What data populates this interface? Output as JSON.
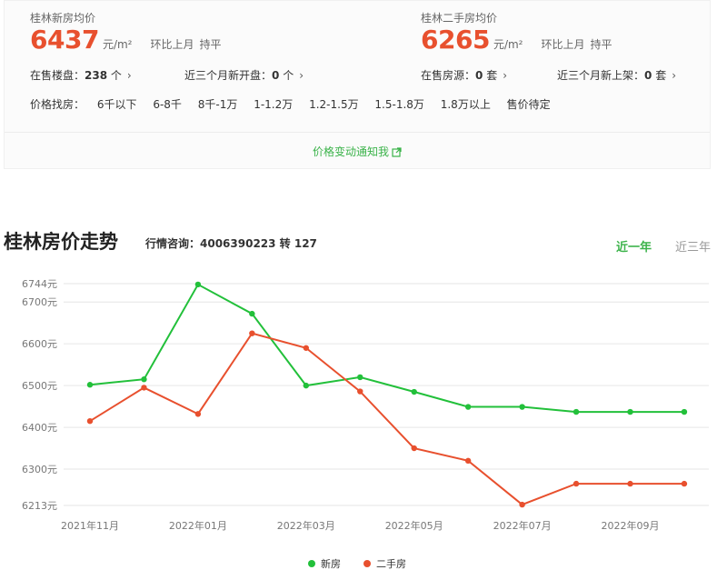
{
  "colors": {
    "new": "#22c03a",
    "second": "#e8502e",
    "accent": "#3bb34a",
    "price": "#e8502e"
  },
  "summary": {
    "new_home": {
      "title": "桂林新房均价",
      "price": "6437",
      "unit": "元/m²",
      "compare_label": "环比上月",
      "compare_value": "持平",
      "stat1_label": "在售楼盘：",
      "stat1_value": "238",
      "stat1_unit": " 个",
      "stat2_label": "近三个月新开盘：",
      "stat2_value": "0",
      "stat2_unit": " 个"
    },
    "second_hand": {
      "title": "桂林二手房均价",
      "price": "6265",
      "unit": "元/m²",
      "compare_label": "环比上月",
      "compare_value": "持平",
      "stat1_label": "在售房源：",
      "stat1_value": "0",
      "stat1_unit": " 套",
      "stat2_label": "近三个月新上架：",
      "stat2_value": "0",
      "stat2_unit": " 套"
    },
    "chevron": "›",
    "filter_label": "价格找房：",
    "filter_options": [
      "6千以下",
      "6-8千",
      "8千-1万",
      "1-1.2万",
      "1.2-1.5万",
      "1.5-1.8万",
      "1.8万以上",
      "售价待定"
    ],
    "notify_text": "价格变动通知我",
    "notify_icon": "external-link-icon"
  },
  "trend": {
    "title": "桂林房价走势",
    "hotline": "行情咨询：4006390223 转 127",
    "tabs": [
      "近一年",
      "近三年"
    ],
    "active_tab": "近一年"
  },
  "chart_data": {
    "type": "line",
    "x": [
      "2021年11月",
      "2021年12月",
      "2022年01月",
      "2022年02月",
      "2022年03月",
      "2022年04月",
      "2022年05月",
      "2022年06月",
      "2022年07月",
      "2022年08月",
      "2022年09月",
      "2022年10月"
    ],
    "x_tick_labels": [
      "2021年11月",
      "2022年01月",
      "2022年03月",
      "2022年05月",
      "2022年07月",
      "2022年09月"
    ],
    "y_tick_labels": [
      "6744元",
      "6700元",
      "6600元",
      "6500元",
      "6400元",
      "6300元",
      "6213元"
    ],
    "y_ticks": [
      6744,
      6700,
      6600,
      6500,
      6400,
      6300,
      6213
    ],
    "ylim": [
      6213,
      6744
    ],
    "series": [
      {
        "name": "新房",
        "color": "#22c03a",
        "values": [
          6502,
          6515,
          6742,
          6672,
          6500,
          6520,
          6485,
          6449,
          6449,
          6437,
          6437,
          6437
        ]
      },
      {
        "name": "二手房",
        "color": "#e8502e",
        "values": [
          6415,
          6495,
          6432,
          6625,
          6590,
          6486,
          6350,
          6320,
          6215,
          6265,
          6265,
          6265
        ]
      }
    ],
    "grid": true,
    "legend_position": "bottom-center"
  }
}
